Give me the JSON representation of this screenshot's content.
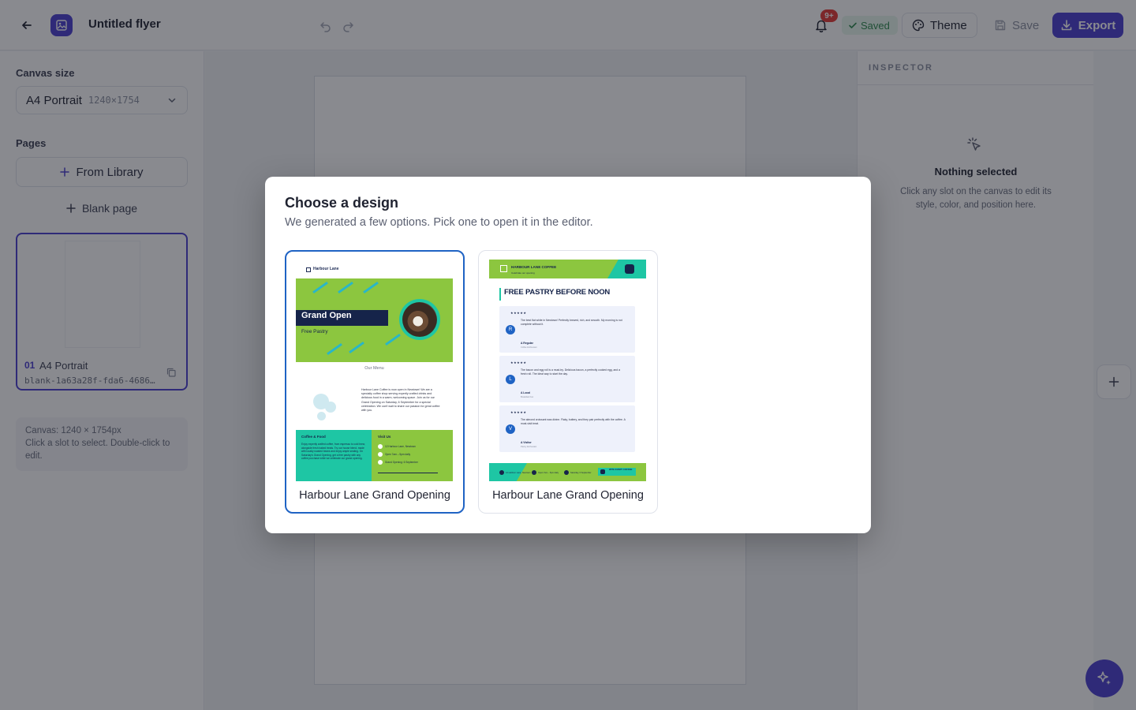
{
  "header": {
    "title": "Untitled flyer",
    "notifications_badge": "9+",
    "saved_label": "Saved",
    "theme_label": "Theme",
    "save_label": "Save",
    "export_label": "Export"
  },
  "sidebar": {
    "canvas_size_label": "Canvas size",
    "canvas_size": {
      "name": "A4 Portrait",
      "dims": "1240×1754"
    },
    "pages_label": "Pages",
    "from_library_label": "From Library",
    "blank_page_label": "Blank page",
    "pages": [
      {
        "number": "01",
        "name": "A4 Portrait",
        "id": "blank-1a63a28f-fda6-4686-93…"
      }
    ],
    "info": "Canvas: 1240 × 1754px\nClick a slot to select. Double-click to edit."
  },
  "inspector": {
    "title": "INSPECTOR",
    "empty_title": "Nothing selected",
    "empty_desc": "Click any slot on the canvas to edit its style, color, and position here."
  },
  "modal": {
    "title": "Choose a design",
    "subtitle": "We generated a few options. Pick one to open it in the editor.",
    "designs": [
      {
        "label": "Harbour Lane Grand Opening",
        "selected": true,
        "thumb": {
          "brand": "Harbour Lane",
          "headline": "Grand Open",
          "tagline": "Free Pastry",
          "menu_title": "Our Menu",
          "about": "Harbour Lane Coffee is now open in Newtown! We are a specialty coffee shop serving expertly crafted drinks and delicious food in a warm, welcoming space. Join us for our Grand Opening on Saturday, 6 September for a special celebration. We can't wait to share our passion for great coffee with you.",
          "col1_title": "Coffee & Food",
          "col1_text": "Enjoy expertly crafted coffee, from espresso to cold brew, alongside fresh baked treats. Try our house blend, made with locally roasted beans and enjoy ample seating. On Saturday's Grand Opening, get a free pastry with any coffee purchase while we celebrate our grand opening.",
          "col2_title": "Visit Us",
          "visit": [
            "12 Harbour Lane, Newtown",
            "Open 7am – 5pm daily",
            "Grand Opening: 6 September"
          ]
        }
      },
      {
        "label": "Harbour Lane Grand Opening",
        "selected": false,
        "thumb": {
          "brand": "HARBOUR LANE COFFEE",
          "brand_sub": "Celebrate our opening",
          "headline": "FREE PASTRY BEFORE NOON",
          "reviews": [
            {
              "avatar": "R",
              "stars": "★★★★★",
              "quote": "The best flat white in Newtown! Perfectly brewed, rich, and smooth. My morning is not complete without it.",
              "author": "A Regular",
              "author_sub": "Coffee Enthusiast"
            },
            {
              "avatar": "L",
              "stars": "★★★★★",
              "quote": "The bacon and egg roll is a must-try. Delicious bacon, a perfectly cooked egg, and a fresh roll. The ideal way to start the day.",
              "author": "A Local",
              "author_sub": "Breakfast Fan"
            },
            {
              "avatar": "V",
              "stars": "★★★★★",
              "quote": "The almond croissant was divine. Flaky, buttery, and they pair perfectly with the coffee. A must-visit treat.",
              "author": "A Visitor",
              "author_sub": "Pastry Enthusiast"
            }
          ],
          "footer_items": [
            "12 Harbour Lane, Newtown",
            "Open 7am – 5pm daily",
            "Saturday, 6 September"
          ],
          "footer_badge": "WITH EVERY COFFEE"
        }
      }
    ]
  },
  "colors": {
    "brand": "#4a3fd0",
    "selection": "#1f63c4",
    "flyer_green": "#8cc63f",
    "flyer_teal": "#1ec6a4",
    "flyer_navy": "#16244a",
    "saved_green": "#2e8a4e",
    "badge_red": "#e53935"
  },
  "icons": [
    "arrow-left-icon",
    "image-icon",
    "undo-icon",
    "redo-icon",
    "bell-icon",
    "check-icon",
    "palette-icon",
    "save-icon",
    "download-icon",
    "chevron-down-icon",
    "plus-icon",
    "copy-icon",
    "pointer-click-icon",
    "sparkles-icon"
  ]
}
